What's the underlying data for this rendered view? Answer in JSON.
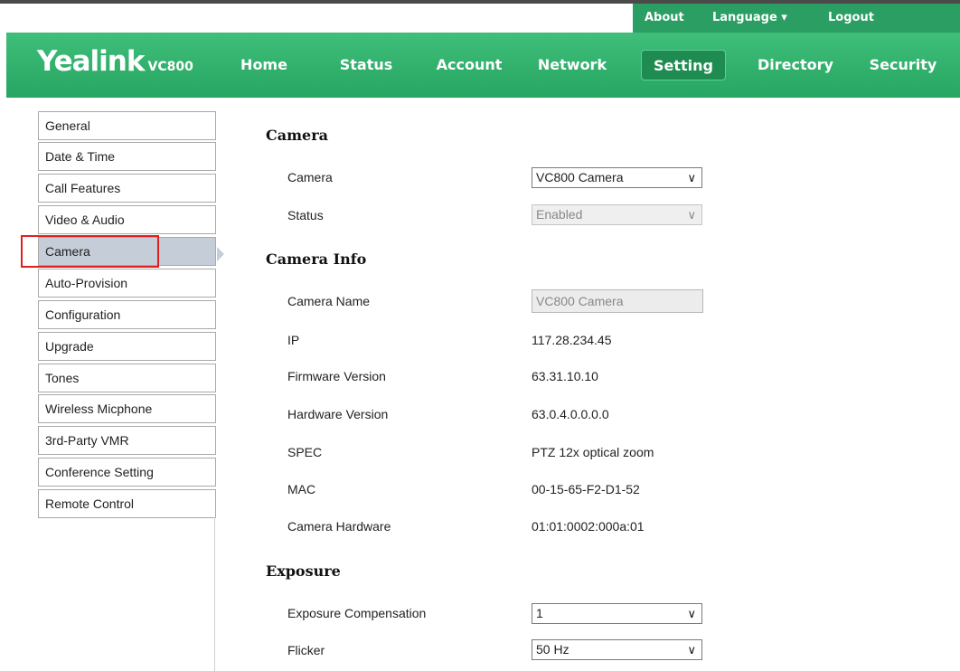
{
  "top_links": {
    "about": "About",
    "language": "Language ▾",
    "logout": "Logout"
  },
  "brand": {
    "name": "Yealink",
    "model": "VC800"
  },
  "nav": {
    "items": [
      {
        "label": "Home"
      },
      {
        "label": "Status"
      },
      {
        "label": "Account"
      },
      {
        "label": "Network"
      },
      {
        "label": "Setting"
      },
      {
        "label": "Directory"
      },
      {
        "label": "Security"
      }
    ],
    "active": "Setting"
  },
  "sidebar": {
    "items": [
      {
        "label": "General"
      },
      {
        "label": "Date & Time"
      },
      {
        "label": "Call Features"
      },
      {
        "label": "Video & Audio"
      },
      {
        "label": "Camera"
      },
      {
        "label": "Auto-Provision"
      },
      {
        "label": "Configuration"
      },
      {
        "label": "Upgrade"
      },
      {
        "label": "Tones"
      },
      {
        "label": "Wireless Micphone"
      },
      {
        "label": "3rd-Party VMR"
      },
      {
        "label": "Conference Setting"
      },
      {
        "label": "Remote Control"
      }
    ],
    "active": "Camera"
  },
  "camera_section": {
    "title": "Camera",
    "camera_label": "Camera",
    "camera_value": "VC800 Camera",
    "status_label": "Status",
    "status_value": "Enabled"
  },
  "camera_info": {
    "title": "Camera Info",
    "name_label": "Camera Name",
    "name_value": "VC800 Camera",
    "ip_label": "IP",
    "ip_value": "117.28.234.45",
    "firmware_label": "Firmware Version",
    "firmware_value": "63.31.10.10",
    "hardware_label": "Hardware Version",
    "hardware_value": "63.0.4.0.0.0.0",
    "spec_label": "SPEC",
    "spec_value": "PTZ 12x optical zoom",
    "mac_label": "MAC",
    "mac_value": "00-15-65-F2-D1-52",
    "cam_hw_label": "Camera Hardware",
    "cam_hw_value": "01:01:0002:000a:01"
  },
  "exposure": {
    "title": "Exposure",
    "comp_label": "Exposure Compensation",
    "comp_value": "1",
    "flicker_label": "Flicker",
    "flicker_value": "50 Hz"
  },
  "colors": {
    "header_green": "#2fae6b",
    "active_tab": "#1e8c51",
    "sidebar_active": "#c5cdd8",
    "highlight_red": "#e02020"
  }
}
